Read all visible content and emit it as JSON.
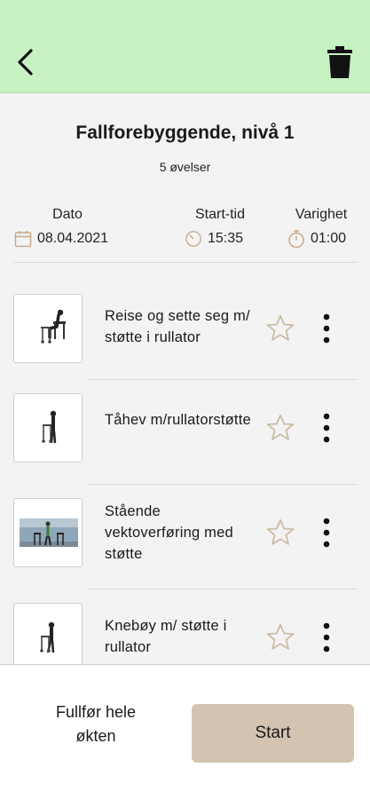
{
  "header": {
    "back_icon": "chevron-left-icon",
    "delete_icon": "trash-icon",
    "color": "#c7f0c3"
  },
  "session": {
    "title": "Fallforebyggende, nivå 1",
    "count_text": "5 øvelser",
    "date_label": "Dato",
    "date_value": "08.04.2021",
    "start_label": "Start-tid",
    "start_value": "15:35",
    "duration_label": "Varighet",
    "duration_value": "01:00"
  },
  "exercises": [
    {
      "name": "Reise og sette seg m/ støtte i rullator"
    },
    {
      "name": "Tåhev m/rullatorstøtte"
    },
    {
      "name": "Stående vektoverføring med støtte"
    },
    {
      "name": "Knebøy m/ støtte i rullator"
    }
  ],
  "footer": {
    "finish_label": "Fullfør hele økten",
    "start_label": "Start",
    "start_color": "#d3c4b2"
  }
}
